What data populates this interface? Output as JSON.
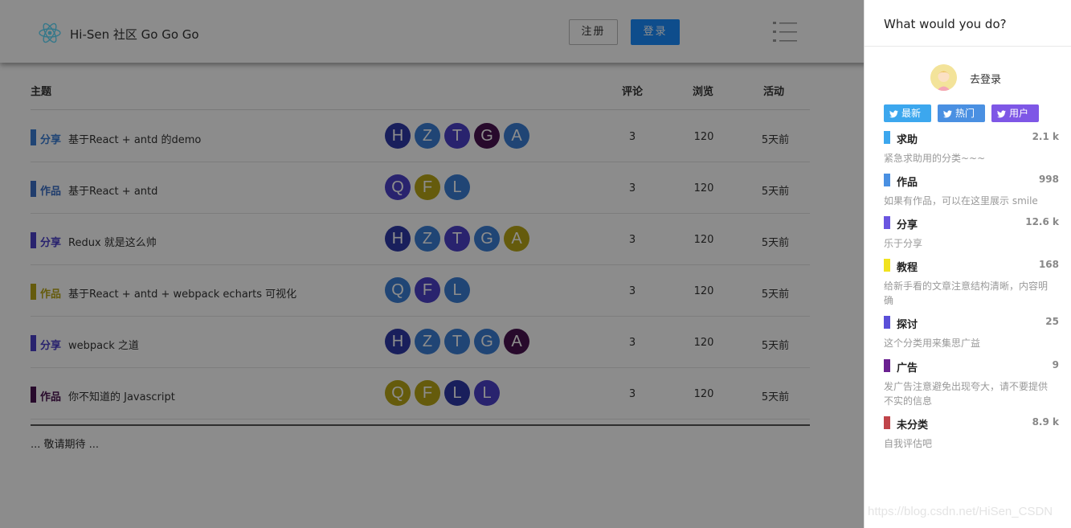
{
  "header": {
    "site_title": "Hi-Sen 社区 Go Go Go",
    "register_label": "注册",
    "login_label": "登录"
  },
  "table": {
    "columns": {
      "topic": "主题",
      "comments": "评论",
      "views": "浏览",
      "activity": "活动"
    },
    "rows": [
      {
        "tag": "分享",
        "tag_color": "#3b7fd6",
        "title": "基于React + antd 的demo",
        "avatars": [
          {
            "letter": "H",
            "color": "#2f3aa8"
          },
          {
            "letter": "Z",
            "color": "#3b7fd6"
          },
          {
            "letter": "T",
            "color": "#4c40c8"
          },
          {
            "letter": "G",
            "color": "#4a1350"
          },
          {
            "letter": "A",
            "color": "#3b7fd6"
          }
        ],
        "comments": "3",
        "views": "120",
        "activity": "5天前"
      },
      {
        "tag": "作品",
        "tag_color": "#3b6fc6",
        "title": "基于React + antd",
        "avatars": [
          {
            "letter": "Q",
            "color": "#4c40c8"
          },
          {
            "letter": "F",
            "color": "#b8a616"
          },
          {
            "letter": "L",
            "color": "#3b7fd6"
          }
        ],
        "comments": "3",
        "views": "120",
        "activity": "5天前"
      },
      {
        "tag": "分享",
        "tag_color": "#4c40c8",
        "title": "Redux 就是这么帅",
        "avatars": [
          {
            "letter": "H",
            "color": "#2f3aa8"
          },
          {
            "letter": "Z",
            "color": "#3b7fd6"
          },
          {
            "letter": "T",
            "color": "#4c40c8"
          },
          {
            "letter": "G",
            "color": "#3b7fd6"
          },
          {
            "letter": "A",
            "color": "#b8a616"
          }
        ],
        "comments": "3",
        "views": "120",
        "activity": "5天前"
      },
      {
        "tag": "作品",
        "tag_color": "#b8a616",
        "title": "基于React + antd + webpack echarts 可视化",
        "avatars": [
          {
            "letter": "Q",
            "color": "#3b7fd6"
          },
          {
            "letter": "F",
            "color": "#4c40c8"
          },
          {
            "letter": "L",
            "color": "#3b7fd6"
          }
        ],
        "comments": "3",
        "views": "120",
        "activity": "5天前"
      },
      {
        "tag": "分享",
        "tag_color": "#4c40c8",
        "title": "webpack 之道",
        "avatars": [
          {
            "letter": "H",
            "color": "#2f3aa8"
          },
          {
            "letter": "Z",
            "color": "#3b7fd6"
          },
          {
            "letter": "T",
            "color": "#3b7fd6"
          },
          {
            "letter": "G",
            "color": "#3b7fd6"
          },
          {
            "letter": "A",
            "color": "#4a1350"
          }
        ],
        "comments": "3",
        "views": "120",
        "activity": "5天前"
      },
      {
        "tag": "作品",
        "tag_color": "#4a1350",
        "title": "你不知道的 Javascript",
        "avatars": [
          {
            "letter": "Q",
            "color": "#b8a616"
          },
          {
            "letter": "F",
            "color": "#b8a616"
          },
          {
            "letter": "L",
            "color": "#2f3aa8"
          },
          {
            "letter": "L",
            "color": "#4c40c8"
          }
        ],
        "comments": "3",
        "views": "120",
        "activity": "5天前"
      }
    ],
    "more_text": "... 敬请期待 ..."
  },
  "drawer": {
    "title": "What would you do?",
    "login_link": "去登录",
    "chips": {
      "latest": "最新",
      "hot": "热门",
      "users": "用户"
    },
    "categories": [
      {
        "name": "求助",
        "count": "2.1 k",
        "desc": "紧急求助用的分类~~~",
        "color": "#3ca7ee"
      },
      {
        "name": "作品",
        "count": "998",
        "desc": "如果有作品，可以在这里展示 smile",
        "color": "#4a90e2"
      },
      {
        "name": "分享",
        "count": "12.6 k",
        "desc": "乐于分享",
        "color": "#6a55e0"
      },
      {
        "name": "教程",
        "count": "168",
        "desc": "给新手看的文章注意结构清晰，内容明确",
        "color": "#f1e21f"
      },
      {
        "name": "探讨",
        "count": "25",
        "desc": "这个分类用来集思广益",
        "color": "#5a4fd8"
      },
      {
        "name": "广告",
        "count": "9",
        "desc": "发广告注意避免出现夸大，请不要提供不实的信息",
        "color": "#6a2090"
      },
      {
        "name": "未分类",
        "count": "8.9 k",
        "desc": "自我评估吧",
        "color": "#c0444a"
      }
    ]
  },
  "watermark": "https://blog.csdn.net/HiSen_CSDN"
}
